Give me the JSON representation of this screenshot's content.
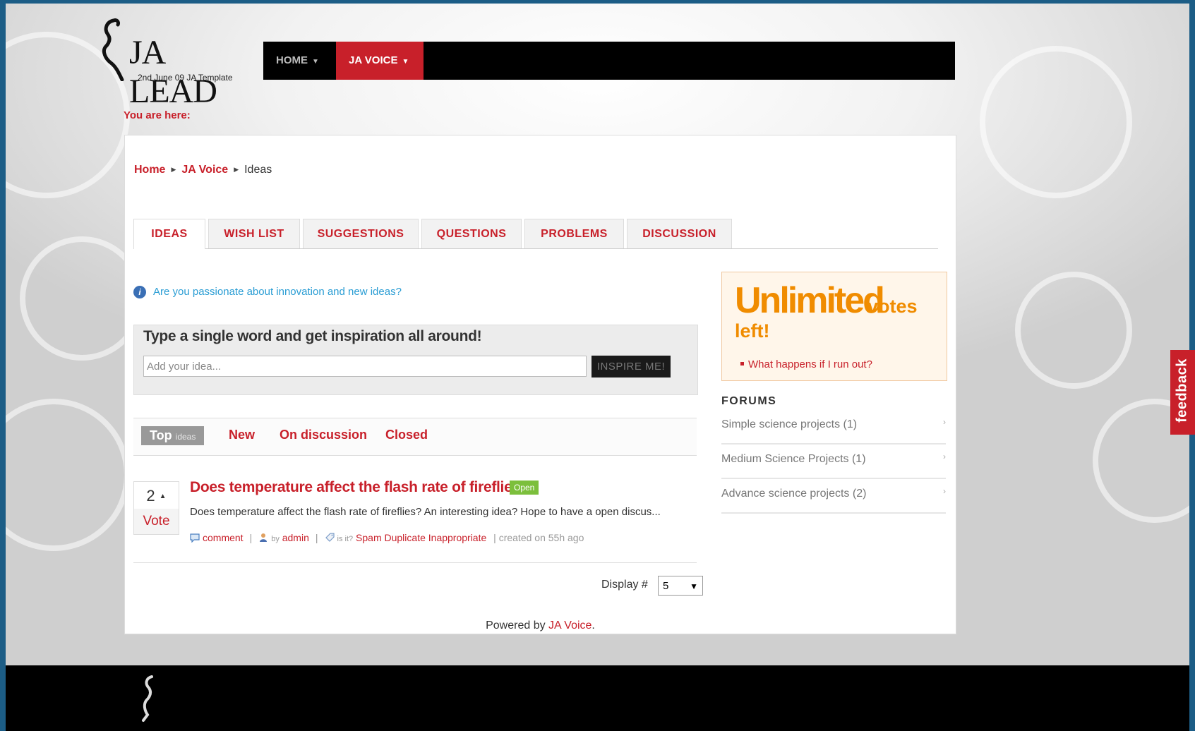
{
  "site": {
    "logo_text": "JA LEAD",
    "logo_sub": "2nd June 09 JA Template"
  },
  "nav": {
    "items": [
      {
        "label": "HOME"
      },
      {
        "label": "JA VOICE"
      }
    ],
    "caret": "▼"
  },
  "you_are_here": "You are here:",
  "breadcrumb": {
    "items": [
      "Home",
      "JA Voice",
      "Ideas"
    ],
    "sep": "▶"
  },
  "tabs": [
    "IDEAS",
    "WISH LIST",
    "SUGGESTIONS",
    "QUESTIONS",
    "PROBLEMS",
    "DISCUSSION"
  ],
  "info": {
    "icon": "i",
    "text": "Are you passionate about innovation and new ideas?"
  },
  "inspire": {
    "heading": "Type a single word and get inspiration all around!",
    "placeholder": "Add your idea...",
    "button": "INSPIRE ME!"
  },
  "filters": {
    "top": "Top",
    "top_small": "ideas",
    "new": "New",
    "on_discussion": "On discussion",
    "closed": "Closed"
  },
  "idea": {
    "votes": "2",
    "vote_up": "▲",
    "vote_label": "Vote",
    "title": "Does temperature affect the flash rate of fireflies?",
    "status": "Open",
    "description": "Does temperature affect the flash rate of fireflies? An interesting idea? Hope to have a open discus...",
    "comment": "comment",
    "by": "by",
    "author": "admin",
    "is_it": "is it?",
    "spam": "Spam",
    "duplicate": "Duplicate",
    "inappropriate": "Inappropriate",
    "created": "| created on 55h ago",
    "separator": "|"
  },
  "display": {
    "label": "Display #",
    "value": "5",
    "arrow": "▼"
  },
  "powered": {
    "prefix": "Powered by ",
    "link": "JA Voice",
    "suffix": "."
  },
  "promo": {
    "big": "Unlimited",
    "votes": "votes",
    "left": "left!",
    "link": "What happens if I run out?"
  },
  "forums": {
    "heading": "FORUMS",
    "arrow": "›",
    "items": [
      "Simple science projects (1)",
      "Medium Science Projects (1)",
      "Advance science projects (2)"
    ]
  },
  "feedback": "feedback",
  "colors": {
    "accent": "#c8202a",
    "orange": "#f08c00",
    "open_badge": "#7cbf3c",
    "info_blue": "#2a9dd4"
  }
}
